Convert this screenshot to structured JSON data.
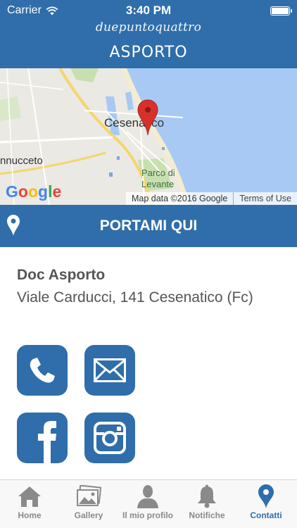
{
  "status_bar": {
    "carrier": "Carrier",
    "time": "3:40 PM"
  },
  "header": {
    "brand": "duepuntoquattro",
    "subtitle": "ASPORTO"
  },
  "map": {
    "city_label": "Cesenatico",
    "place_1": "nnucceto",
    "place_2_line1": "Parco di",
    "place_2_line2": "Levante",
    "google_logo": "Google",
    "attribution": "Map data ©2016 Google",
    "terms_link": "Terms of Use"
  },
  "navigate": {
    "label": "PORTAMI QUI"
  },
  "business": {
    "name": "Doc Asporto",
    "address": "Viale Carducci, 141 Cesenatico (Fc)"
  },
  "contacts": [
    {
      "icon": "phone-icon"
    },
    {
      "icon": "mail-icon"
    },
    {
      "icon": "facebook-icon"
    },
    {
      "icon": "instagram-icon"
    }
  ],
  "tabs": [
    {
      "label": "Home",
      "icon": "home-icon"
    },
    {
      "label": "Gallery",
      "icon": "gallery-icon"
    },
    {
      "label": "Il mio profilo",
      "icon": "profile-icon"
    },
    {
      "label": "Notifiche",
      "icon": "bell-icon"
    },
    {
      "label": "Contatti",
      "icon": "location-pin-icon",
      "active": true
    }
  ],
  "colors": {
    "primary": "#2f6eaa",
    "tab_inactive": "#8a8a8a",
    "text": "#555555",
    "pin_red": "#d8312b"
  }
}
